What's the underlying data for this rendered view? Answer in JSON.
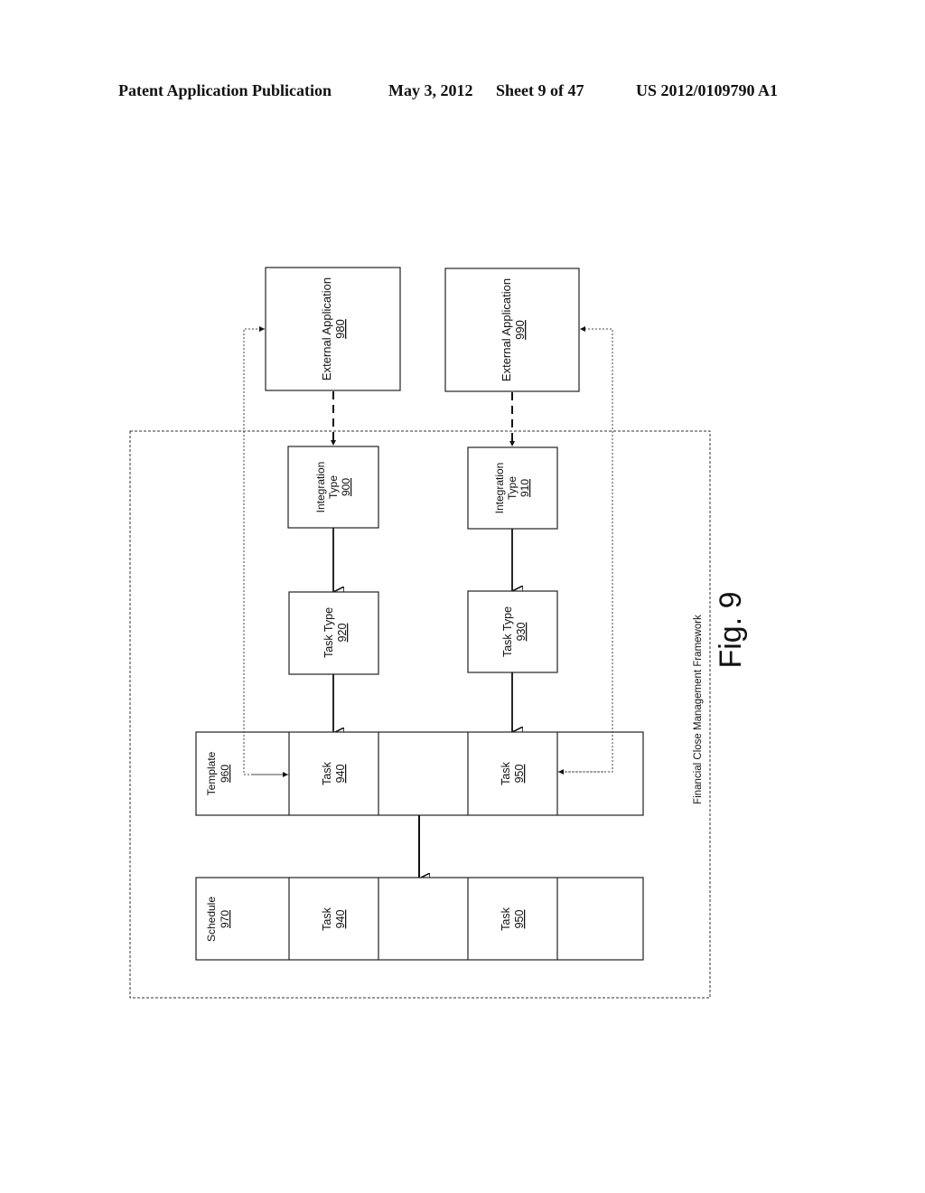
{
  "header": {
    "publication": "Patent Application Publication",
    "date": "May 3, 2012",
    "sheet": "Sheet 9 of 47",
    "number": "US 2012/0109790 A1"
  },
  "figure": {
    "label": "Fig. 9",
    "framework_label": "Financial Close Management Framework",
    "nodes": {
      "ext_app_980": {
        "line1": "External Application",
        "ref": "980"
      },
      "ext_app_990": {
        "line1": "External Application",
        "ref": "990"
      },
      "integration_900": {
        "line1": "Integration",
        "line2": "Type",
        "ref": "900"
      },
      "integration_910": {
        "line1": "Integration",
        "line2": "Type",
        "ref": "910"
      },
      "task_type_920": {
        "line1": "Task Type",
        "ref": "920"
      },
      "task_type_930": {
        "line1": "Task Type",
        "ref": "930"
      },
      "template_960": {
        "line1": "Template",
        "ref": "960",
        "tasks": [
          {
            "line1": "Task",
            "ref": "940"
          },
          {
            "line1": "Task",
            "ref": "950"
          }
        ]
      },
      "schedule_970": {
        "line1": "Schedule",
        "ref": "970",
        "tasks": [
          {
            "line1": "Task",
            "ref": "940"
          },
          {
            "line1": "Task",
            "ref": "950"
          }
        ]
      }
    }
  }
}
